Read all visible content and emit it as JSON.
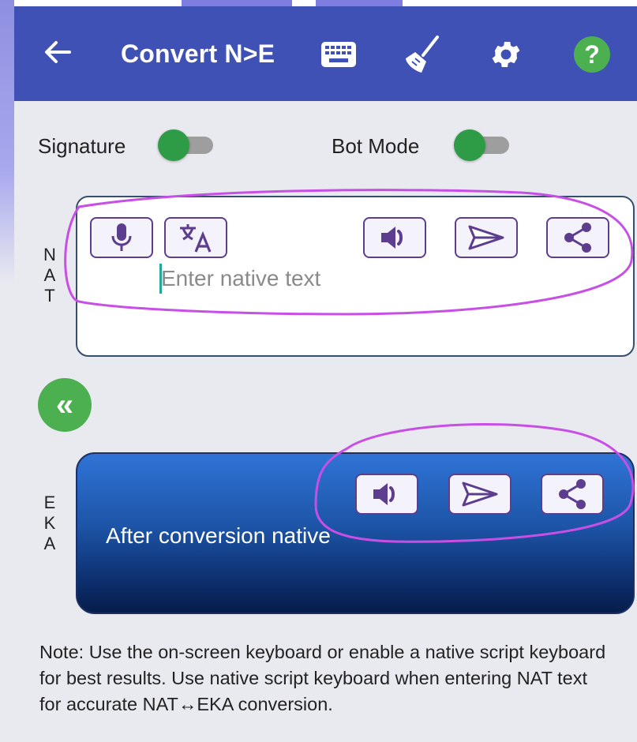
{
  "appbar": {
    "back_icon": "arrow-left-icon",
    "title": "Convert N>E",
    "actions": [
      {
        "name": "keyboard-icon"
      },
      {
        "name": "broom-icon"
      },
      {
        "name": "gear-icon"
      },
      {
        "name": "help-icon",
        "glyph": "?"
      }
    ],
    "color": "#3f51b5"
  },
  "toggles": {
    "signature_label": "Signature",
    "bot_mode_label": "Bot Mode"
  },
  "nat": {
    "side_label": [
      "N",
      "A",
      "T"
    ],
    "placeholder": "Enter native text",
    "buttons": [
      "microphone-icon",
      "translate-icon",
      "speaker-icon",
      "send-icon",
      "share-icon"
    ]
  },
  "swap": {
    "glyph": "«"
  },
  "eka": {
    "side_label": [
      "E",
      "K",
      "A"
    ],
    "output_text": "After conversion native",
    "buttons": [
      "speaker-icon",
      "send-icon",
      "share-icon"
    ]
  },
  "note": {
    "text": "Note: Use the on-screen keyboard or enable a native script keyboard for best results. Use native script keyboard when entering NAT text for accurate NAT↔EKA conversion."
  },
  "colors": {
    "accent_green": "#4caf50",
    "icon_purple": "#5c3d8e",
    "annotation": "#c84fe6"
  }
}
